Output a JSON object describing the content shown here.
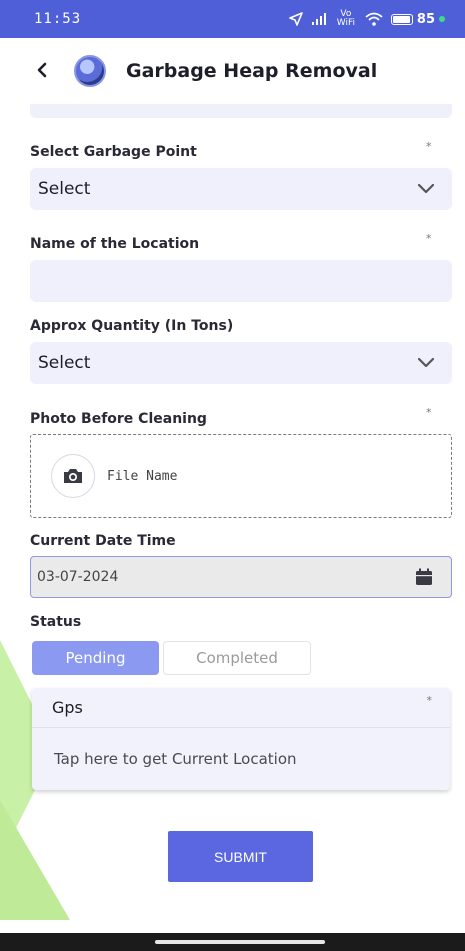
{
  "status_bar": {
    "time": "11:53",
    "network": "Vo WiFi",
    "battery": "85"
  },
  "header": {
    "back_icon": "chevron-left-icon",
    "title": "Garbage Heap Removal"
  },
  "form": {
    "garbage_point": {
      "label": "Select Garbage Point",
      "required": "*",
      "value": "Select"
    },
    "location_name": {
      "label": "Name of the Location",
      "required": "*",
      "value": ""
    },
    "quantity": {
      "label": "Approx Quantity (In Tons)",
      "value": "Select"
    },
    "photo": {
      "label": "Photo Before Cleaning",
      "required": "*",
      "file_name": "File Name"
    },
    "date_time": {
      "label": "Current Date Time",
      "value": "03-07-2024"
    },
    "status": {
      "label": "Status",
      "options": [
        "Pending",
        "Completed"
      ],
      "selected": "Pending"
    },
    "gps": {
      "label": "Gps",
      "required": "*",
      "action": "Tap here to get Current Location"
    },
    "submit_label": "SUBMIT"
  },
  "colors": {
    "primary": "#4e5fd8",
    "selected_toggle": "#8b9af0",
    "field_bg": "#eff0fb",
    "accent_green": "#c8f0a6"
  }
}
